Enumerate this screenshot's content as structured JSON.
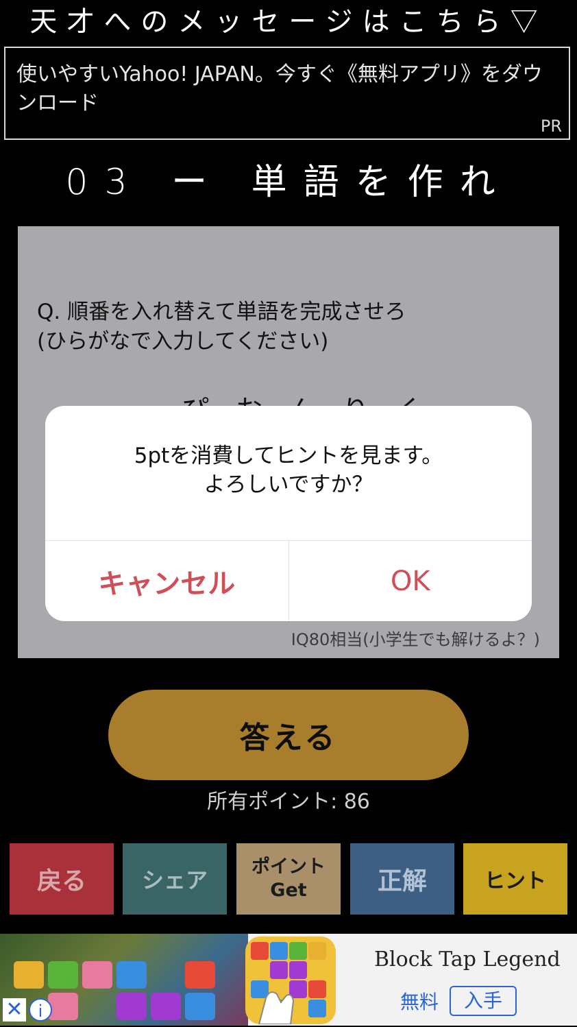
{
  "banner": {
    "text": "天才へのメッセージはこちら▽"
  },
  "ad_top": {
    "text": "使いやすいYahoo! JAPAN。今すぐ《無料アプリ》をダウンロード",
    "badge": "PR"
  },
  "stage": {
    "title": "03 ー 単語を作れ"
  },
  "question": {
    "line1": "Q. 順番を入れ替えて単語を完成させろ",
    "line2": "(ひらがなで入力してください)",
    "letters": "っぴおんりく",
    "level": "IQ80相当(小学生でも解けるよ？)"
  },
  "dialog": {
    "line1": "5ptを消費してヒントを見ます。",
    "line2": "よろしいですか？",
    "cancel_label": "キャンセル",
    "ok_label": "OK"
  },
  "answer_button": {
    "label": "答える"
  },
  "points": {
    "text": "所有ポイント: 86"
  },
  "toolbar": {
    "back": "戻る",
    "share": "シェア",
    "points_get_line1": "ポイント",
    "points_get_line2": "Get",
    "correct": "正解",
    "hint": "ヒント"
  },
  "ad_bottom": {
    "app_name": "Block Tap Legend",
    "free": "無料",
    "get": "入手",
    "close_icon": "close-icon",
    "info_icon": "info-icon"
  }
}
